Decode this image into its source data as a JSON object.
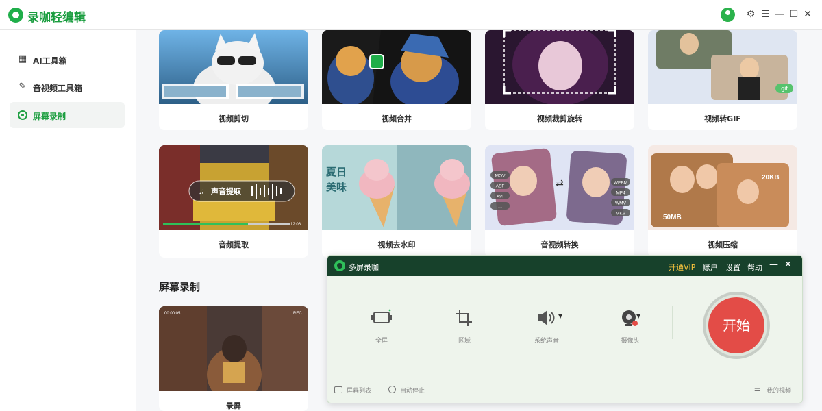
{
  "app": {
    "title": "录咖轻编辑"
  },
  "titlebar": {
    "icons": [
      "avatar-icon",
      "settings-icon",
      "menu-icon",
      "minimize-icon",
      "maximize-icon",
      "close-icon"
    ]
  },
  "sidebar": {
    "items": [
      {
        "label": "AI工具箱",
        "icon": "grid-icon",
        "active": false
      },
      {
        "label": "音视频工具箱",
        "icon": "pencil-icon",
        "active": false
      },
      {
        "label": "屏幕录制",
        "icon": "record-icon",
        "active": true
      }
    ]
  },
  "tools": {
    "row1": [
      {
        "label": "视频剪切"
      },
      {
        "label": "视频合并"
      },
      {
        "label": "视频裁剪旋转"
      },
      {
        "label": "视频转GIF"
      }
    ],
    "row2": [
      {
        "label": "音频提取"
      },
      {
        "label": "视频去水印"
      },
      {
        "label": "音视频转换"
      },
      {
        "label": "视频压缩"
      }
    ]
  },
  "thumb_text": {
    "audio_extract_overlay": "声音提取",
    "audio_time": "12:06",
    "watermark_text": "夏日\n美味",
    "formats_left": [
      "MOV",
      "ASF",
      "AVI",
      "......"
    ],
    "formats_right": [
      "WEBM",
      "MP4",
      "WMV",
      "MKV"
    ],
    "size_before": "50MB",
    "size_after": "20KB",
    "gif_badge": "gif",
    "rec_time": "00:00:05",
    "rec_badge": "REC"
  },
  "screen_record": {
    "section_title": "屏幕录制",
    "card_label": "录屏"
  },
  "recorder": {
    "title": "多屏录咖",
    "links": [
      "开通VIP",
      "账户",
      "设置",
      "帮助"
    ],
    "tools": [
      {
        "label": "全屏",
        "icon": "fullscreen-icon"
      },
      {
        "label": "区域",
        "icon": "crop-icon"
      },
      {
        "label": "系统声音",
        "icon": "speaker-icon"
      },
      {
        "label": "摄像头",
        "icon": "webcam-icon"
      }
    ],
    "start_label": "开始",
    "footer": {
      "screen_list": "屏幕列表",
      "auto_stop": "自动停止",
      "my_videos": "我的视频"
    }
  }
}
